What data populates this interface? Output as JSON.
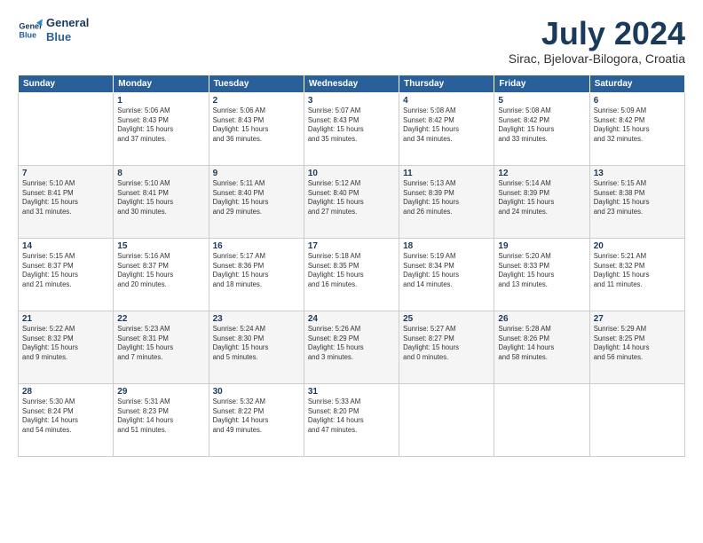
{
  "header": {
    "logo_line1": "General",
    "logo_line2": "Blue",
    "month": "July 2024",
    "location": "Sirac, Bjelovar-Bilogora, Croatia"
  },
  "weekdays": [
    "Sunday",
    "Monday",
    "Tuesday",
    "Wednesday",
    "Thursday",
    "Friday",
    "Saturday"
  ],
  "weeks": [
    [
      {
        "day": "",
        "info": ""
      },
      {
        "day": "1",
        "info": "Sunrise: 5:06 AM\nSunset: 8:43 PM\nDaylight: 15 hours\nand 37 minutes."
      },
      {
        "day": "2",
        "info": "Sunrise: 5:06 AM\nSunset: 8:43 PM\nDaylight: 15 hours\nand 36 minutes."
      },
      {
        "day": "3",
        "info": "Sunrise: 5:07 AM\nSunset: 8:43 PM\nDaylight: 15 hours\nand 35 minutes."
      },
      {
        "day": "4",
        "info": "Sunrise: 5:08 AM\nSunset: 8:42 PM\nDaylight: 15 hours\nand 34 minutes."
      },
      {
        "day": "5",
        "info": "Sunrise: 5:08 AM\nSunset: 8:42 PM\nDaylight: 15 hours\nand 33 minutes."
      },
      {
        "day": "6",
        "info": "Sunrise: 5:09 AM\nSunset: 8:42 PM\nDaylight: 15 hours\nand 32 minutes."
      }
    ],
    [
      {
        "day": "7",
        "info": "Sunrise: 5:10 AM\nSunset: 8:41 PM\nDaylight: 15 hours\nand 31 minutes."
      },
      {
        "day": "8",
        "info": "Sunrise: 5:10 AM\nSunset: 8:41 PM\nDaylight: 15 hours\nand 30 minutes."
      },
      {
        "day": "9",
        "info": "Sunrise: 5:11 AM\nSunset: 8:40 PM\nDaylight: 15 hours\nand 29 minutes."
      },
      {
        "day": "10",
        "info": "Sunrise: 5:12 AM\nSunset: 8:40 PM\nDaylight: 15 hours\nand 27 minutes."
      },
      {
        "day": "11",
        "info": "Sunrise: 5:13 AM\nSunset: 8:39 PM\nDaylight: 15 hours\nand 26 minutes."
      },
      {
        "day": "12",
        "info": "Sunrise: 5:14 AM\nSunset: 8:39 PM\nDaylight: 15 hours\nand 24 minutes."
      },
      {
        "day": "13",
        "info": "Sunrise: 5:15 AM\nSunset: 8:38 PM\nDaylight: 15 hours\nand 23 minutes."
      }
    ],
    [
      {
        "day": "14",
        "info": "Sunrise: 5:15 AM\nSunset: 8:37 PM\nDaylight: 15 hours\nand 21 minutes."
      },
      {
        "day": "15",
        "info": "Sunrise: 5:16 AM\nSunset: 8:37 PM\nDaylight: 15 hours\nand 20 minutes."
      },
      {
        "day": "16",
        "info": "Sunrise: 5:17 AM\nSunset: 8:36 PM\nDaylight: 15 hours\nand 18 minutes."
      },
      {
        "day": "17",
        "info": "Sunrise: 5:18 AM\nSunset: 8:35 PM\nDaylight: 15 hours\nand 16 minutes."
      },
      {
        "day": "18",
        "info": "Sunrise: 5:19 AM\nSunset: 8:34 PM\nDaylight: 15 hours\nand 14 minutes."
      },
      {
        "day": "19",
        "info": "Sunrise: 5:20 AM\nSunset: 8:33 PM\nDaylight: 15 hours\nand 13 minutes."
      },
      {
        "day": "20",
        "info": "Sunrise: 5:21 AM\nSunset: 8:32 PM\nDaylight: 15 hours\nand 11 minutes."
      }
    ],
    [
      {
        "day": "21",
        "info": "Sunrise: 5:22 AM\nSunset: 8:32 PM\nDaylight: 15 hours\nand 9 minutes."
      },
      {
        "day": "22",
        "info": "Sunrise: 5:23 AM\nSunset: 8:31 PM\nDaylight: 15 hours\nand 7 minutes."
      },
      {
        "day": "23",
        "info": "Sunrise: 5:24 AM\nSunset: 8:30 PM\nDaylight: 15 hours\nand 5 minutes."
      },
      {
        "day": "24",
        "info": "Sunrise: 5:26 AM\nSunset: 8:29 PM\nDaylight: 15 hours\nand 3 minutes."
      },
      {
        "day": "25",
        "info": "Sunrise: 5:27 AM\nSunset: 8:27 PM\nDaylight: 15 hours\nand 0 minutes."
      },
      {
        "day": "26",
        "info": "Sunrise: 5:28 AM\nSunset: 8:26 PM\nDaylight: 14 hours\nand 58 minutes."
      },
      {
        "day": "27",
        "info": "Sunrise: 5:29 AM\nSunset: 8:25 PM\nDaylight: 14 hours\nand 56 minutes."
      }
    ],
    [
      {
        "day": "28",
        "info": "Sunrise: 5:30 AM\nSunset: 8:24 PM\nDaylight: 14 hours\nand 54 minutes."
      },
      {
        "day": "29",
        "info": "Sunrise: 5:31 AM\nSunset: 8:23 PM\nDaylight: 14 hours\nand 51 minutes."
      },
      {
        "day": "30",
        "info": "Sunrise: 5:32 AM\nSunset: 8:22 PM\nDaylight: 14 hours\nand 49 minutes."
      },
      {
        "day": "31",
        "info": "Sunrise: 5:33 AM\nSunset: 8:20 PM\nDaylight: 14 hours\nand 47 minutes."
      },
      {
        "day": "",
        "info": ""
      },
      {
        "day": "",
        "info": ""
      },
      {
        "day": "",
        "info": ""
      }
    ]
  ]
}
